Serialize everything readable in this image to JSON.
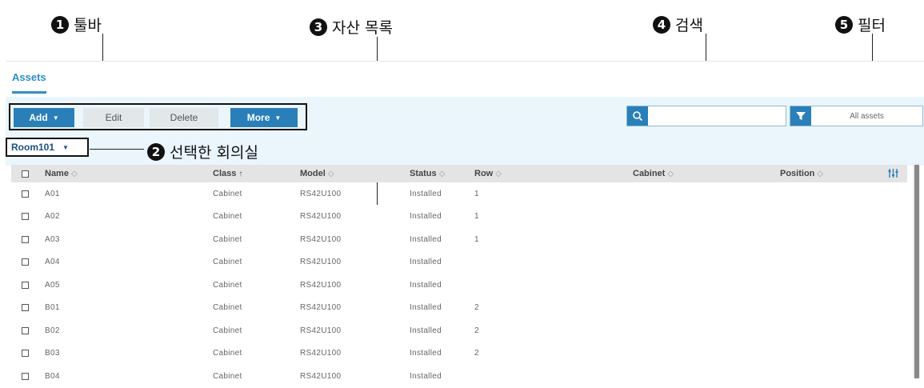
{
  "annotations": [
    {
      "num": "1",
      "label": "툴바"
    },
    {
      "num": "2",
      "label": "선택한 회의실"
    },
    {
      "num": "3",
      "label": "자산 목록"
    },
    {
      "num": "4",
      "label": "검색"
    },
    {
      "num": "5",
      "label": "필터"
    }
  ],
  "tabs": {
    "assets": "Assets"
  },
  "toolbar": {
    "add": "Add",
    "edit": "Edit",
    "delete": "Delete",
    "more": "More"
  },
  "search": {
    "placeholder": "",
    "icon": "search-icon"
  },
  "filter": {
    "value": "All assets",
    "icon": "filter-icon"
  },
  "room": {
    "value": "Room101"
  },
  "table": {
    "columns": [
      "Name",
      "Class",
      "Model",
      "Status",
      "Row",
      "Cabinet",
      "Position"
    ],
    "rows": [
      [
        "A01",
        "Cabinet",
        "RS42U100",
        "Installed",
        "1",
        "",
        ""
      ],
      [
        "A02",
        "Cabinet",
        "RS42U100",
        "Installed",
        "1",
        "",
        ""
      ],
      [
        "A03",
        "Cabinet",
        "RS42U100",
        "Installed",
        "1",
        "",
        ""
      ],
      [
        "A04",
        "Cabinet",
        "RS42U100",
        "Installed",
        "",
        "",
        ""
      ],
      [
        "A05",
        "Cabinet",
        "RS42U100",
        "Installed",
        "",
        "",
        ""
      ],
      [
        "B01",
        "Cabinet",
        "RS42U100",
        "Installed",
        "2",
        "",
        ""
      ],
      [
        "B02",
        "Cabinet",
        "RS42U100",
        "Installed",
        "2",
        "",
        ""
      ],
      [
        "B03",
        "Cabinet",
        "RS42U100",
        "Installed",
        "2",
        "",
        ""
      ],
      [
        "B04",
        "Cabinet",
        "RS42U100",
        "Installed",
        "",
        "",
        ""
      ]
    ]
  },
  "colors": {
    "accent": "#2b7fb8",
    "tab": "#2f8fc8",
    "toolbar_bg": "#eaf6fb"
  }
}
